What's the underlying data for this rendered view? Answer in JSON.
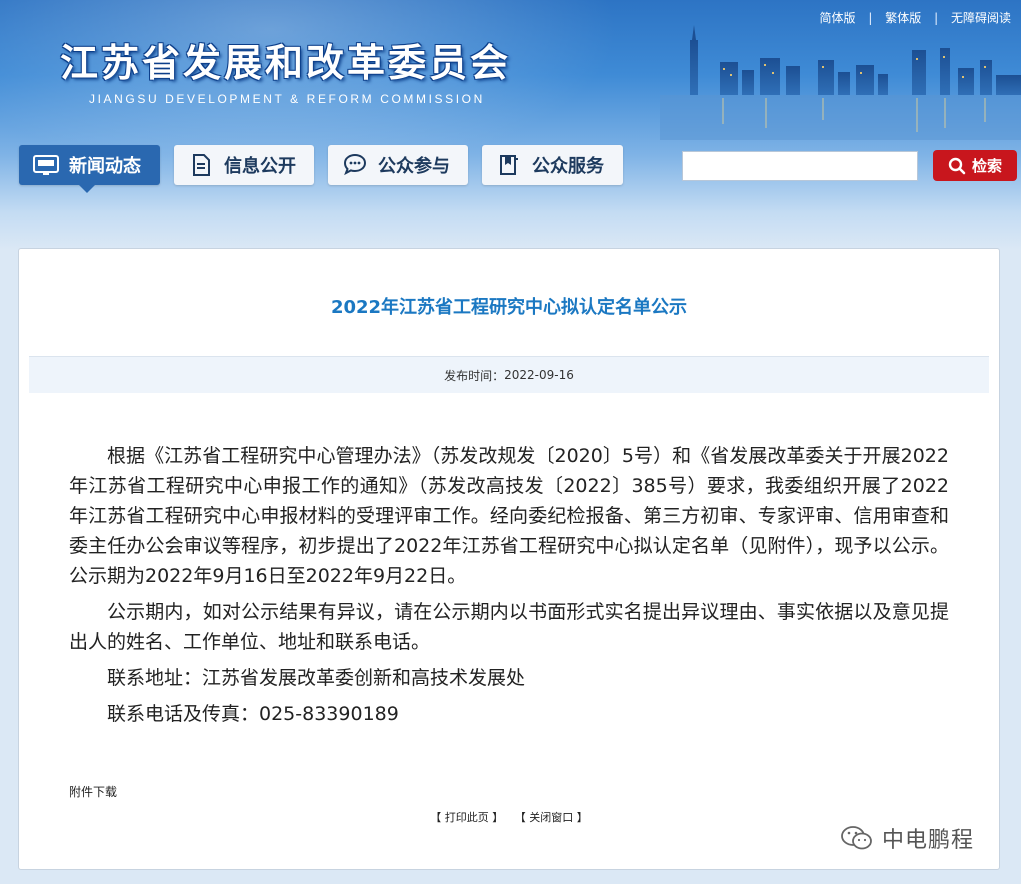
{
  "header": {
    "site_title": "江苏省发展和改革委员会",
    "site_subtitle": "JIANGSU DEVELOPMENT & REFORM COMMISSION",
    "top_links": [
      "简体版",
      "繁体版",
      "无障碍阅读"
    ],
    "nav": [
      {
        "label": "新闻动态",
        "icon": "news-icon",
        "active": true
      },
      {
        "label": "信息公开",
        "icon": "document-icon",
        "active": false
      },
      {
        "label": "公众参与",
        "icon": "chat-icon",
        "active": false
      },
      {
        "label": "公众服务",
        "icon": "book-icon",
        "active": false
      }
    ],
    "search": {
      "value": "",
      "button_label": "检索"
    }
  },
  "article": {
    "title": "2022年江苏省工程研究中心拟认定名单公示",
    "publish_label": "发布时间：",
    "publish_date": "2022-09-16",
    "paragraphs": [
      "根据《江苏省工程研究中心管理办法》（苏发改规发〔2020〕5号）和《省发展改革委关于开展2022年江苏省工程研究中心申报工作的通知》（苏发改高技发〔2022〕385号）要求，我委组织开展了2022年江苏省工程研究中心申报材料的受理评审工作。经向委纪检报备、第三方初审、专家评审、信用审查和委主任办公会审议等程序，初步提出了2022年江苏省工程研究中心拟认定名单（见附件），现予以公示。公示期为2022年9月16日至2022年9月22日。",
      "公示期内，如对公示结果有异议，请在公示期内以书面形式实名提出异议理由、事实依据以及意见提出人的姓名、工作单位、地址和联系电话。",
      "联系地址：江苏省发展改革委创新和高技术发展处",
      "联系电话及传真：025-83390189"
    ],
    "attachment_label": "附件下载",
    "print_label": "【 打印此页 】",
    "close_label": "【 关闭窗口 】"
  },
  "watermark": "中电鹏程",
  "colors": {
    "title_blue": "#1b78c2",
    "nav_active": "#2a68b0",
    "search_red": "#c8161d"
  }
}
